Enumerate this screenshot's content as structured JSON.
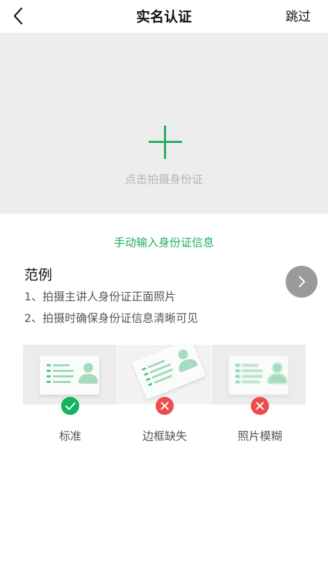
{
  "header": {
    "title": "实名认证",
    "skip_label": "跳过"
  },
  "capture": {
    "label": "点击拍摄身份证"
  },
  "manual_entry": {
    "label": "手动输入身份证信息"
  },
  "example": {
    "title": "范例",
    "items": [
      "1、拍摄主讲人身份证正面照片",
      "2、拍摄时确保身份证信息清晰可见"
    ]
  },
  "samples": [
    {
      "caption": "标准",
      "status": "correct"
    },
    {
      "caption": "边框缺失",
      "status": "wrong"
    },
    {
      "caption": "照片模糊",
      "status": "wrong"
    }
  ],
  "colors": {
    "accent": "#1fb060",
    "error": "#ee4d4d",
    "ok": "#14b35e"
  }
}
